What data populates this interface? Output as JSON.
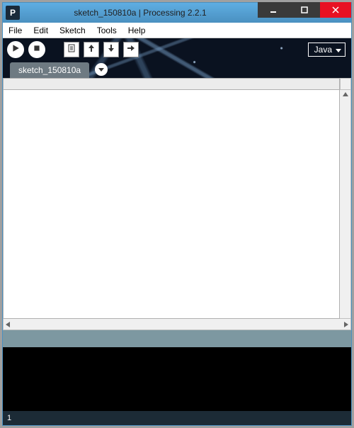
{
  "window": {
    "app_icon_letter": "P",
    "title": "sketch_150810a | Processing 2.2.1"
  },
  "menu": {
    "items": [
      "File",
      "Edit",
      "Sketch",
      "Tools",
      "Help"
    ]
  },
  "toolbar": {
    "mode_label": "Java"
  },
  "tabs": {
    "active": "sketch_150810a"
  },
  "editor": {
    "content": ""
  },
  "status": {
    "line_number": "1"
  }
}
